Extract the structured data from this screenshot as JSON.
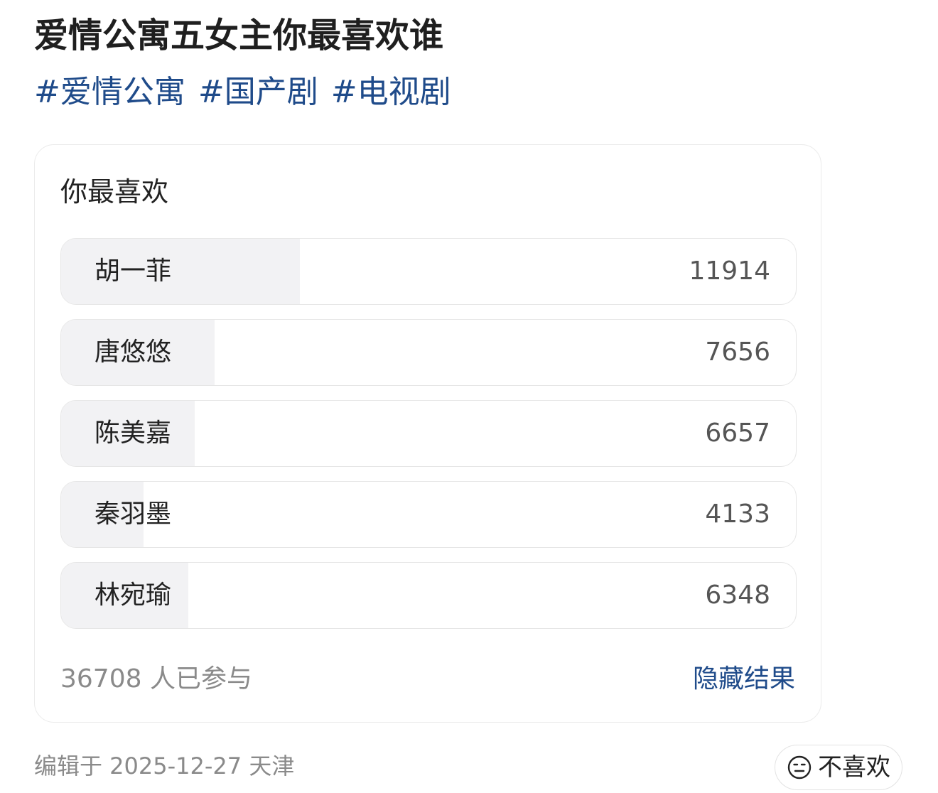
{
  "post": {
    "title": "爱情公寓五女主你最喜欢谁",
    "tags": [
      "#爱情公寓",
      "#国产剧",
      "#电视剧"
    ]
  },
  "poll": {
    "question": "你最喜欢",
    "options": [
      {
        "label": "胡一菲",
        "count": "11914",
        "share": 0.3246
      },
      {
        "label": "唐悠悠",
        "count": "7656",
        "share": 0.2086
      },
      {
        "label": "陈美嘉",
        "count": "6657",
        "share": 0.1814
      },
      {
        "label": "秦羽墨",
        "count": "4133",
        "share": 0.1126
      },
      {
        "label": "林宛瑜",
        "count": "6348",
        "share": 0.1729
      }
    ],
    "participants": "36708 人已参与",
    "hide_results_label": "隐藏结果"
  },
  "meta": {
    "edited": "编辑于 2025-12-27 天津"
  },
  "actions": {
    "dislike_label": "不喜欢",
    "dislike_icon": "neutral-face-icon"
  }
}
